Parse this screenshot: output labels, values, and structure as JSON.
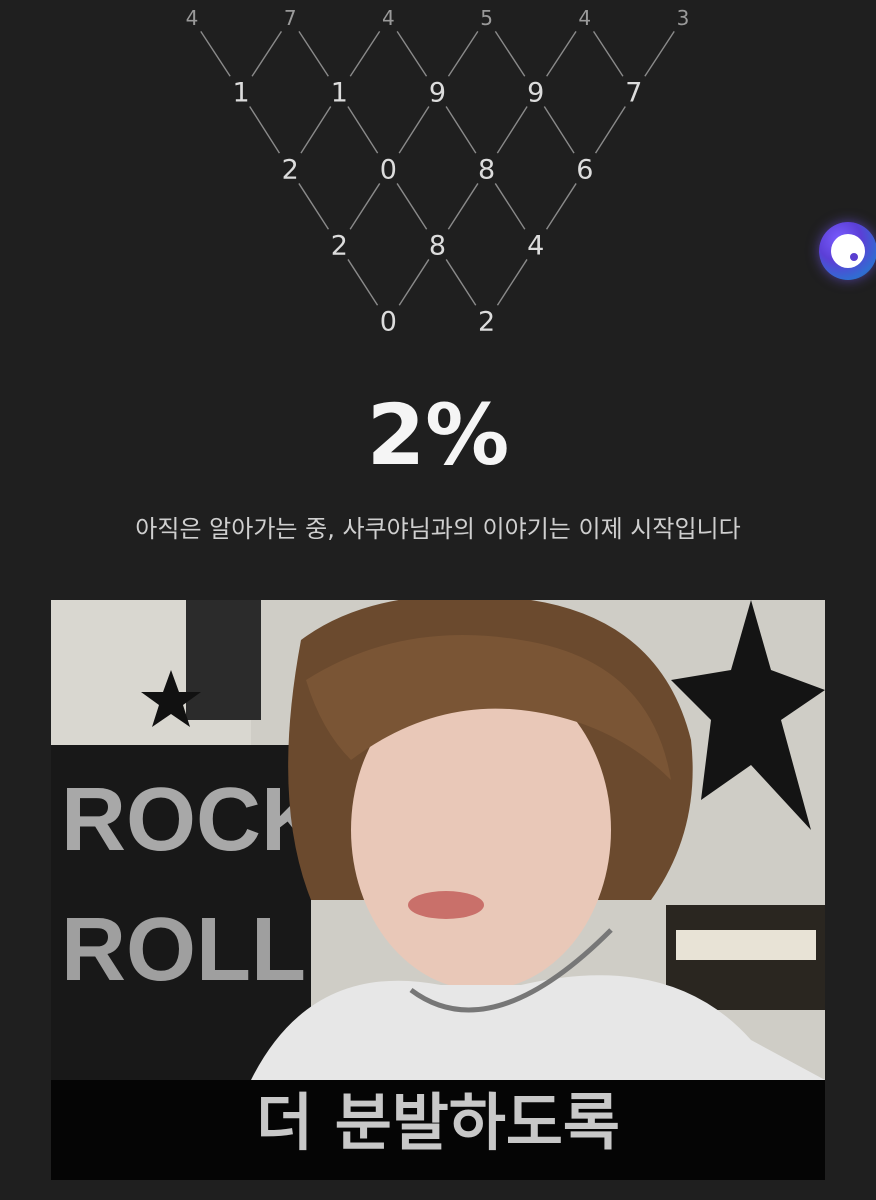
{
  "triangle": {
    "rows": [
      [
        "4",
        "7",
        "4",
        "5",
        "4",
        "3"
      ],
      [
        "1",
        "1",
        "9",
        "9",
        "7"
      ],
      [
        "2",
        "0",
        "8",
        "6"
      ],
      [
        "2",
        "8",
        "4"
      ],
      [
        "0",
        "2"
      ]
    ]
  },
  "result": {
    "percent": "2%",
    "message": "아직은 알아가는 중, 사쿠야님과의 이야기는 이제 시작입니다"
  },
  "photo": {
    "caption": "더 분발하도록"
  },
  "fab_icon": "assistant-bubble-icon"
}
